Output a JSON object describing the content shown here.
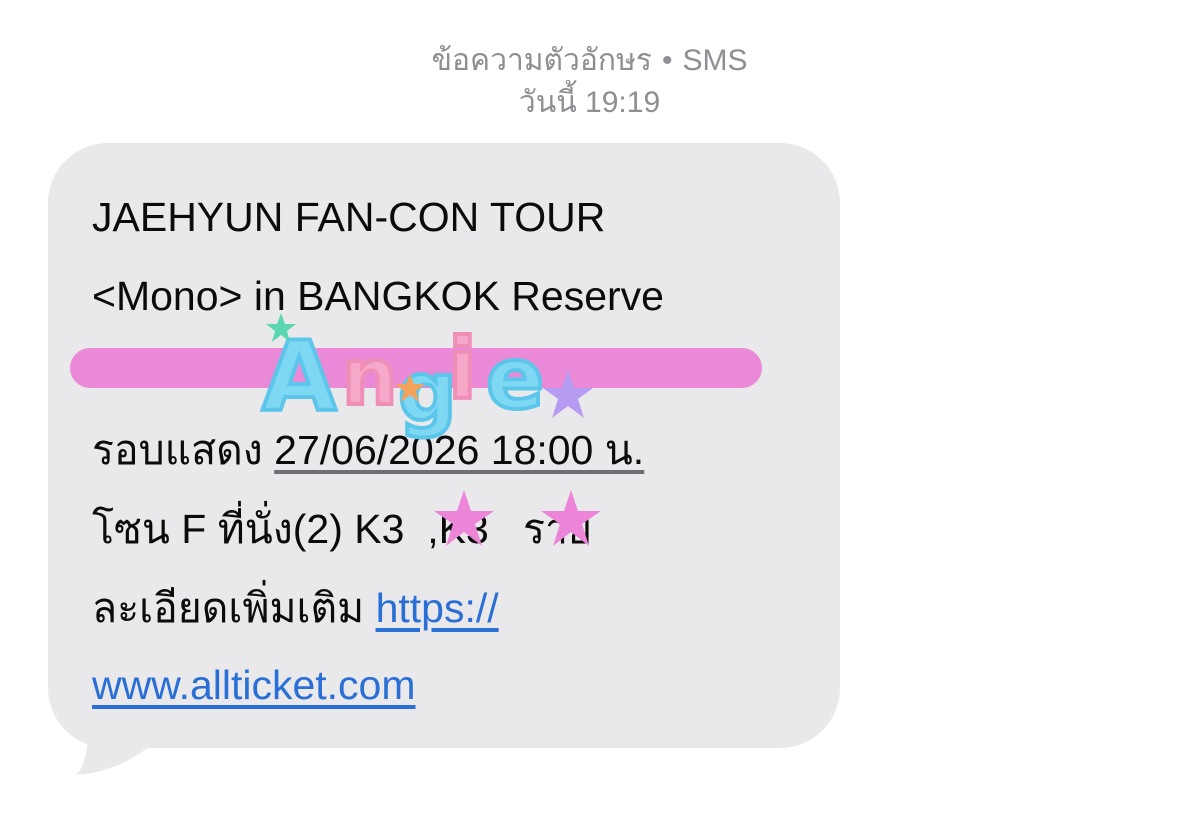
{
  "header": {
    "service": "ข้อความตัวอักษร",
    "separator": "•",
    "type": "SMS",
    "timestamp": "วันนี้ 19:19"
  },
  "message": {
    "line1": "JAEHYUN FAN-CON TOUR",
    "line2": "<Mono> in BANGKOK Reserve",
    "line4_prefix": "รอบแสดง ",
    "line4_date": "27/06/2026 18:00 น.",
    "line5_prefix": "โซน F ที่นั่ง(2) K3",
    "line5_mid": ",K3",
    "line5_suffix": " ราย",
    "line6_prefix": "ละเอียดเพิ่มเติม ",
    "line6_link": "https://",
    "line7_link": "www.allticket.com"
  },
  "sticker": {
    "text": "Angie"
  },
  "colors": {
    "bubble": "#e9e9eb",
    "link": "#2a6fd6",
    "redact_bar": "#ea89d8",
    "star_pink": "#ec84d8",
    "sticker_blue": "#7fd8f3",
    "sticker_pink": "#f6a8c8"
  }
}
